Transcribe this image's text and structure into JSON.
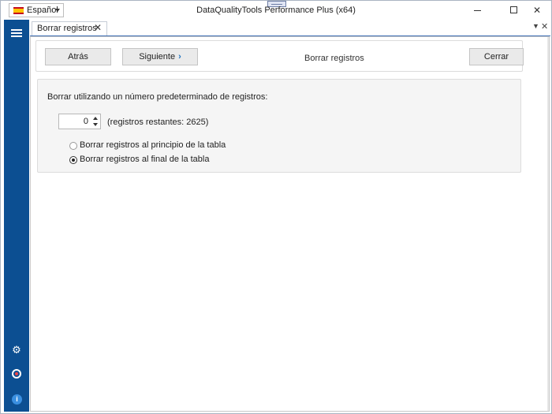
{
  "window": {
    "title": "DataQualityTools Performance Plus (x64)",
    "language": "Español",
    "controls": {
      "minimize": "",
      "maximize": "",
      "close": "✕"
    }
  },
  "sidebar": {
    "icons": [
      "menu-icon",
      "gear-icon",
      "help-icon",
      "info-icon"
    ],
    "accent_color": "#0c4f92"
  },
  "tabs": [
    {
      "label": "Borrar registros",
      "close": "✕"
    }
  ],
  "tabstrip_controls": {
    "dropdown": "▼",
    "close": "✕"
  },
  "toolbar": {
    "back_label": "Atrás",
    "next_label": "Siguiente",
    "next_arrow": "›",
    "title": "Borrar registros",
    "close_label": "Cerrar"
  },
  "panel": {
    "heading": "Borrar utilizando un número predeterminado de registros:",
    "count_value": "0",
    "remaining_text": "(registros restantes: 2625)",
    "options": [
      {
        "label": "Borrar registros al principio de la tabla",
        "selected": false
      },
      {
        "label": "Borrar registros al final de la tabla",
        "selected": true
      }
    ]
  }
}
